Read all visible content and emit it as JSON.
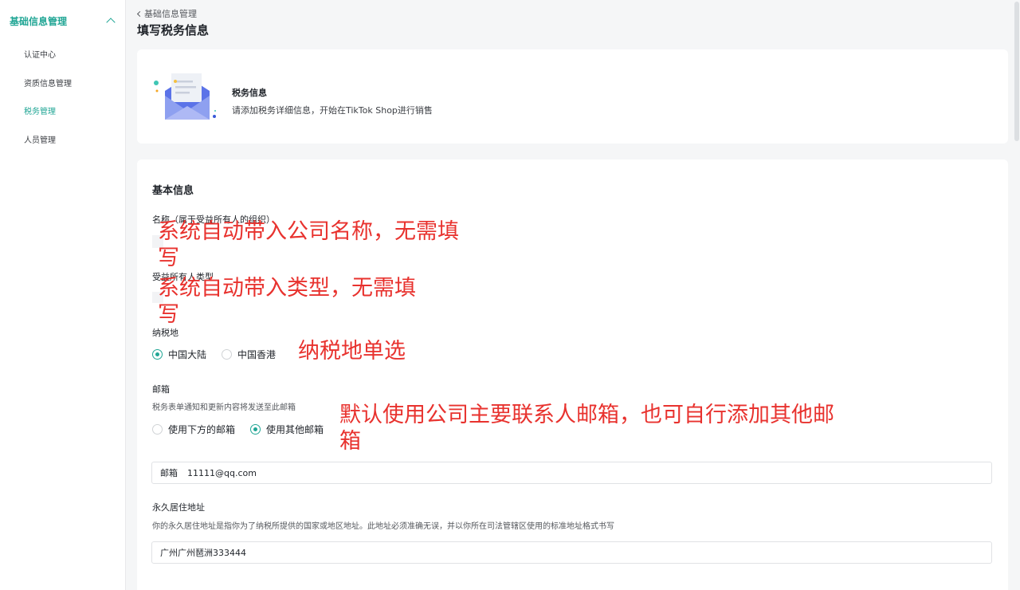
{
  "sidebar": {
    "group_label": "基础信息管理",
    "items": [
      {
        "label": "认证中心",
        "active": false
      },
      {
        "label": "资质信息管理",
        "active": false
      },
      {
        "label": "税务管理",
        "active": true
      },
      {
        "label": "人员管理",
        "active": false
      }
    ]
  },
  "header": {
    "back_label": "基础信息管理",
    "page_title": "填写税务信息"
  },
  "info_card": {
    "title": "税务信息",
    "description": "请添加税务详细信息，开始在TikTok Shop进行销售"
  },
  "form": {
    "section_title": "基本信息",
    "name_label": "名称（属于受益所有人的组织）",
    "owner_type_label": "受益所有人类型",
    "tax_location": {
      "label": "纳税地",
      "options": [
        "中国大陆",
        "中国香港"
      ],
      "selected": "中国大陆"
    },
    "email": {
      "label": "邮箱",
      "hint": "税务表单通知和更新内容将发送至此邮箱",
      "options": [
        "使用下方的邮箱",
        "使用其他邮箱"
      ],
      "selected": "使用其他邮箱",
      "input_prefix": "邮箱",
      "input_value": "11111@qq.com"
    },
    "address": {
      "label": "永久居住地址",
      "hint": "你的永久居住地址是指你为了纳税所提供的国家或地区地址。此地址必须准确无误，并以你所在司法管辖区使用的标准地址格式书写",
      "value": "广州广州琶洲333444"
    }
  },
  "annotations": {
    "name_note_line1": "系统自动带入公司名称，无需填",
    "name_note_line2": "写",
    "type_note_line1": "系统自动带入类型，无需填",
    "type_note_line2": "写",
    "tax_note": "纳税地单选",
    "email_note_line1": "默认使用公司主要联系人邮箱，也可自行添加其他邮",
    "email_note_line2": "箱"
  },
  "colors": {
    "accent": "#21a695",
    "annotation": "#e8322e",
    "background": "#f5f6f7"
  }
}
